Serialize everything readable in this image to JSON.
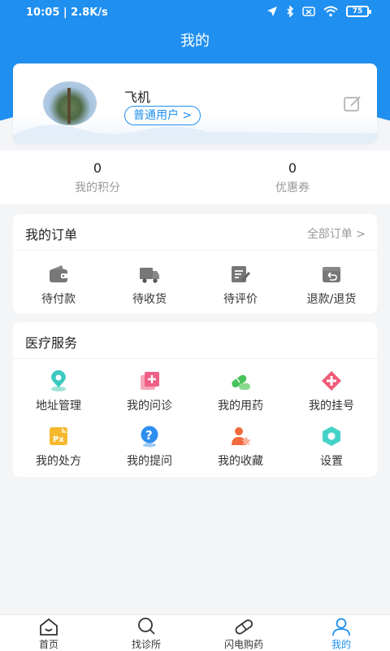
{
  "status": {
    "time": "10:05 | 2.8K/s",
    "battery": "75"
  },
  "page_title": "我的",
  "profile": {
    "name": "飞机",
    "level": "普通用户"
  },
  "stats": [
    {
      "value": "0",
      "label": "我的积分"
    },
    {
      "value": "0",
      "label": "优惠券"
    }
  ],
  "orders": {
    "title": "我的订单",
    "all_link": "全部订单",
    "items": [
      {
        "label": "待付款",
        "icon": "wallet-icon"
      },
      {
        "label": "待收货",
        "icon": "truck-icon"
      },
      {
        "label": "待评价",
        "icon": "review-icon"
      },
      {
        "label": "退款/退货",
        "icon": "refund-icon"
      }
    ]
  },
  "services": {
    "title": "医疗服务",
    "items": [
      {
        "label": "地址管理",
        "icon": "location-icon"
      },
      {
        "label": "我的问诊",
        "icon": "consult-icon"
      },
      {
        "label": "我的用药",
        "icon": "pill-icon"
      },
      {
        "label": "我的挂号",
        "icon": "register-icon"
      },
      {
        "label": "我的处方",
        "icon": "prescription-icon"
      },
      {
        "label": "我的提问",
        "icon": "question-icon"
      },
      {
        "label": "我的收藏",
        "icon": "favorite-icon"
      },
      {
        "label": "设置",
        "icon": "settings-icon"
      }
    ]
  },
  "tabs": [
    {
      "label": "首页",
      "icon": "home-icon"
    },
    {
      "label": "找诊所",
      "icon": "search-icon"
    },
    {
      "label": "闪电购药",
      "icon": "capsule-icon"
    },
    {
      "label": "我的",
      "icon": "person-icon"
    }
  ],
  "colors": {
    "primary": "#1f8ff0",
    "background": "#f4f5f7"
  }
}
